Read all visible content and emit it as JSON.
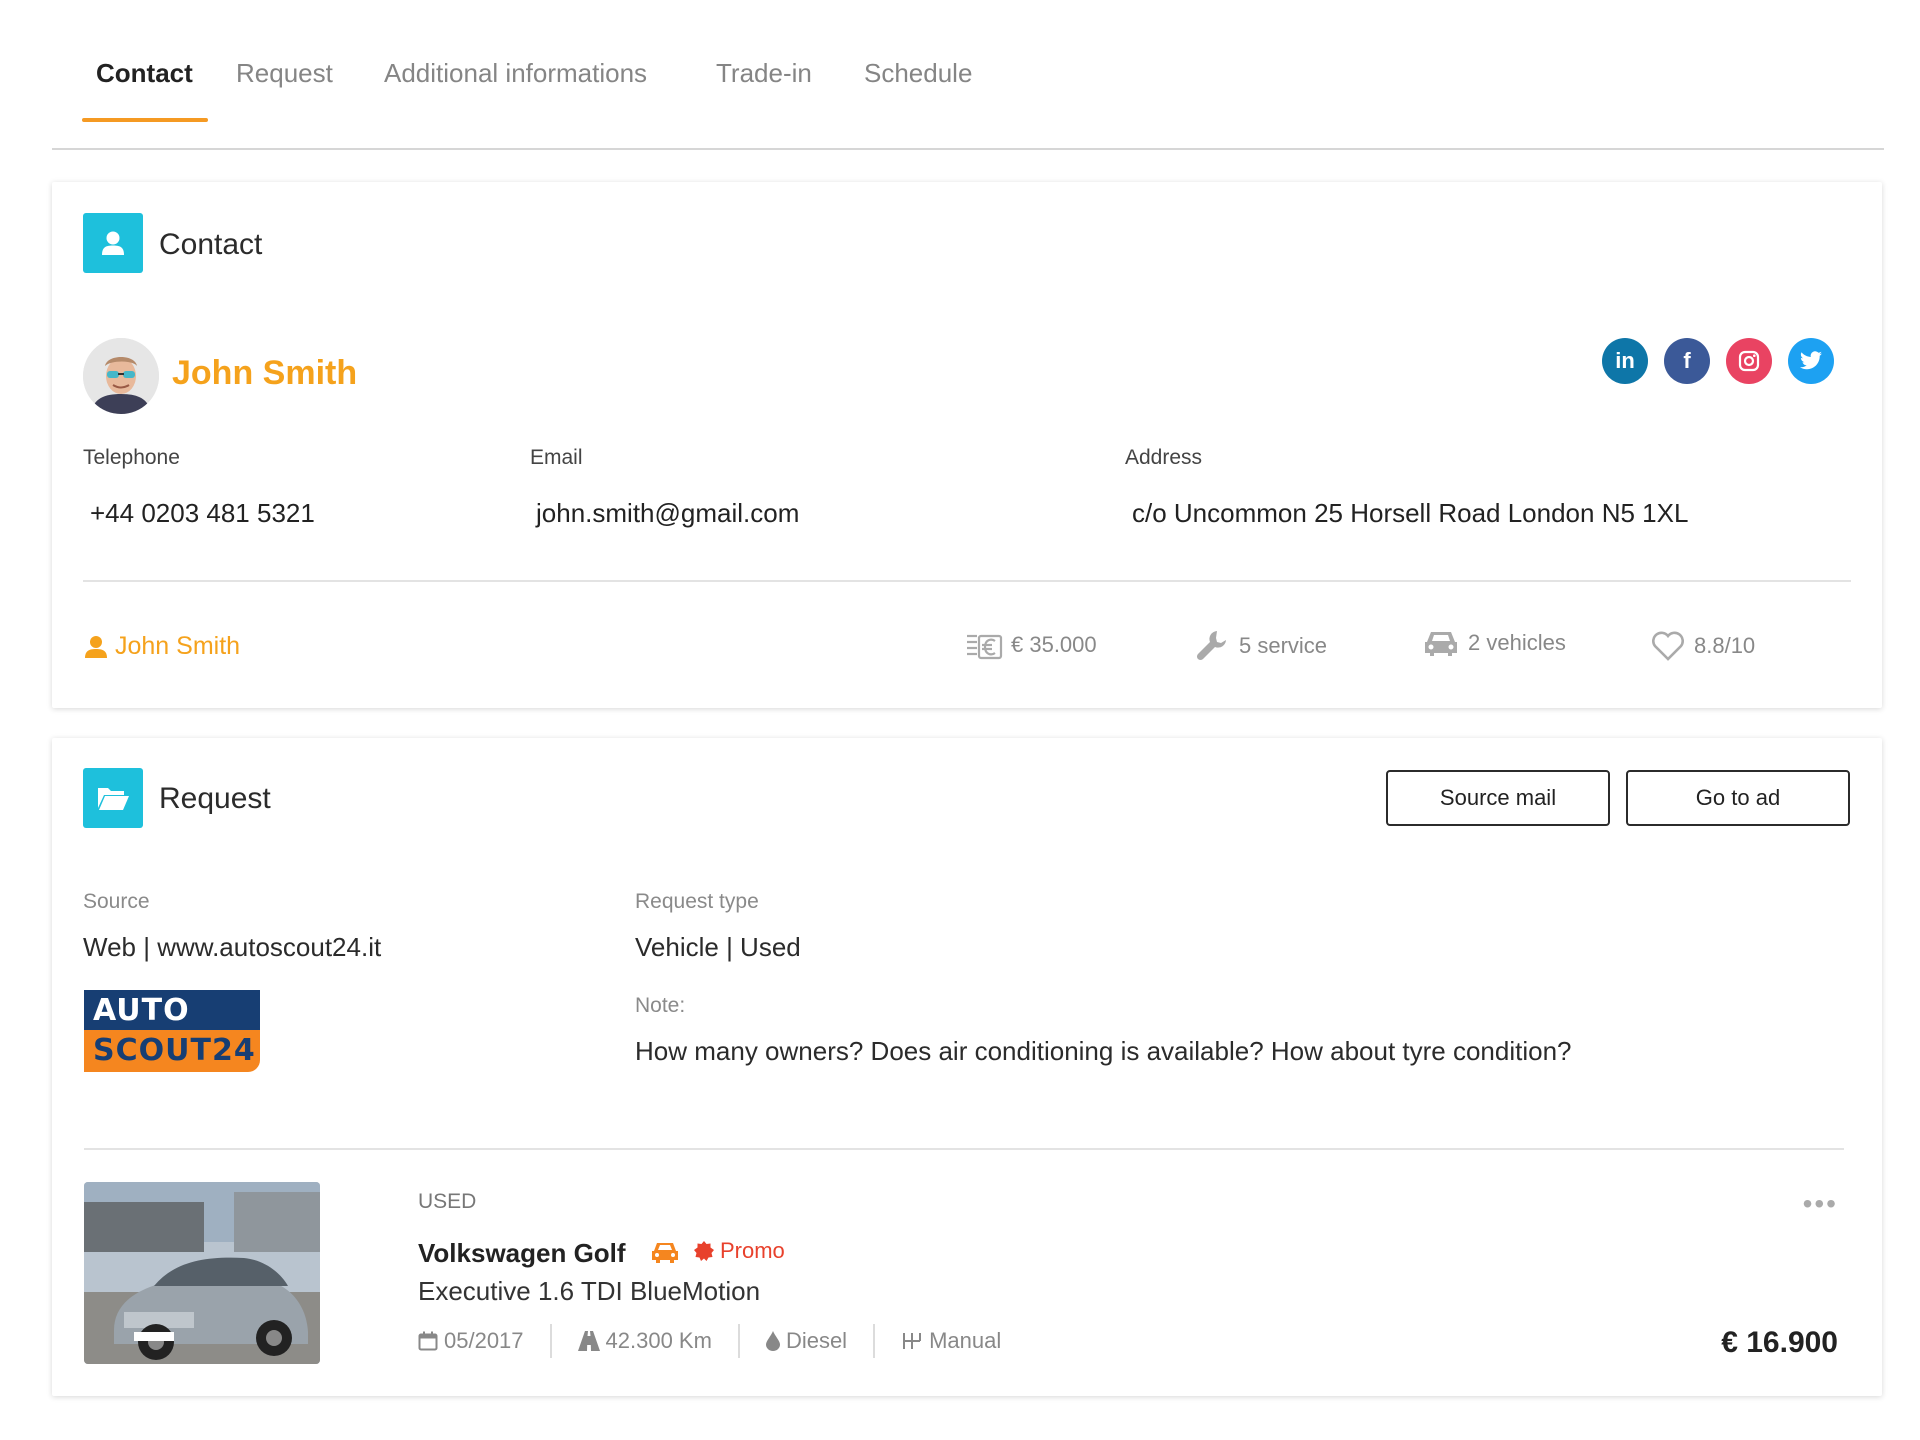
{
  "tabs": [
    {
      "label": "Contact",
      "active": true
    },
    {
      "label": "Request",
      "active": false
    },
    {
      "label": "Additional informations",
      "active": false
    },
    {
      "label": "Trade-in",
      "active": false
    },
    {
      "label": "Schedule",
      "active": false
    }
  ],
  "contact": {
    "section_title": "Contact",
    "name": "John Smith",
    "socials": [
      "linkedin-icon",
      "facebook-icon",
      "instagram-icon",
      "twitter-icon"
    ],
    "telephone_label": "Telephone",
    "telephone": "+44 0203 481 5321",
    "email_label": "Email",
    "email": "john.smith@gmail.com",
    "address_label": "Address",
    "address": "c/o Uncommon 25 Horsell Road London N5 1XL",
    "owner_name": "John Smith",
    "stats": {
      "spend": "€ 35.000",
      "service": "5 service",
      "vehicles": "2 vehicles",
      "rating": "8.8/10"
    }
  },
  "request": {
    "section_title": "Request",
    "source_mail_button": "Source mail",
    "go_to_ad_button": "Go to ad",
    "source_label": "Source",
    "source_value": "Web | www.autoscout24.it",
    "logo_top": "AUTO",
    "logo_bottom": "SCOUT24",
    "request_type_label": "Request type",
    "request_type_value": "Vehicle | Used",
    "note_label": "Note:",
    "note_value": "How many owners? Does air conditioning is available? How about tyre condition?"
  },
  "vehicle": {
    "condition": "USED",
    "title": "Volkswagen Golf",
    "promo": "Promo",
    "subtitle": "Executive 1.6 TDI BlueMotion",
    "date": "05/2017",
    "mileage": "42.300 Km",
    "fuel": "Diesel",
    "transmission": "Manual",
    "price": "€ 16.900"
  },
  "colors": {
    "accent": "#f59a23",
    "section_icon": "#1ec0dc",
    "promo": "#e8412c",
    "linkedin": "#0e76a8",
    "facebook": "#3b5998",
    "instagram": "#e94362",
    "twitter": "#1da1f2"
  }
}
